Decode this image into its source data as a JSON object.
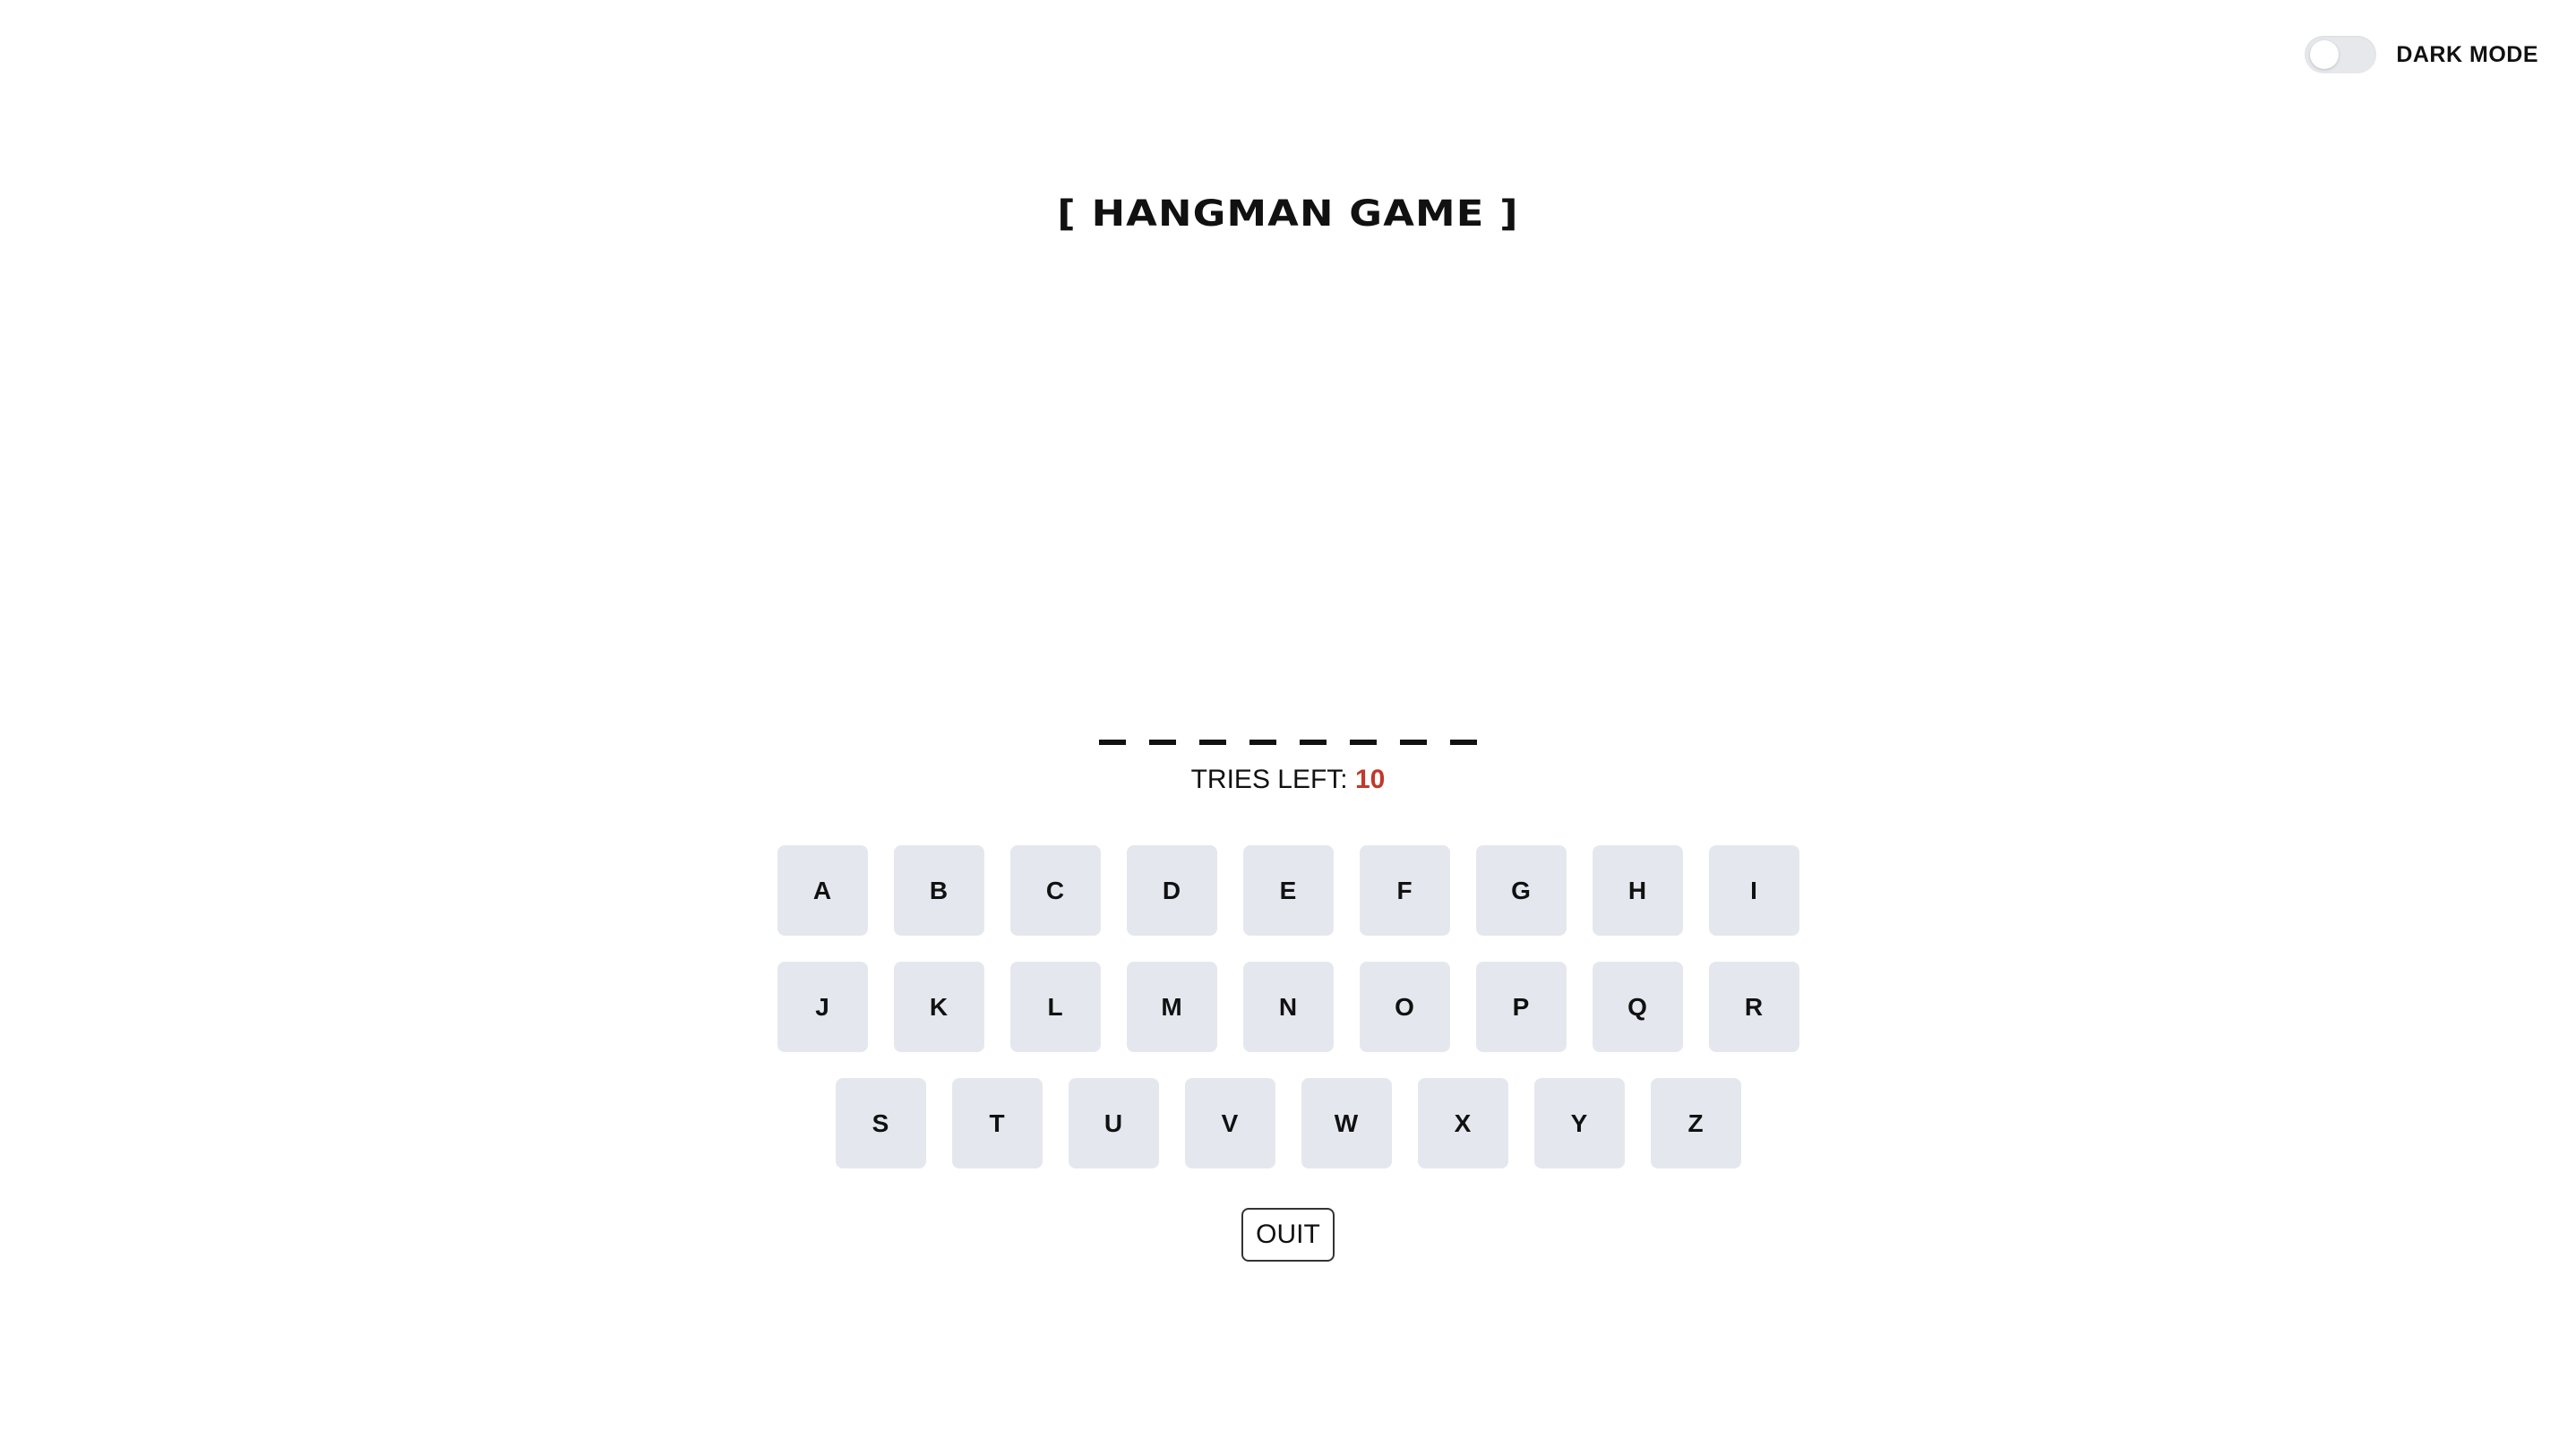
{
  "header": {
    "dark_mode_label": "DARK MODE",
    "dark_mode_on": false
  },
  "game": {
    "title": "[ HANGMAN GAME ]",
    "word_length": 8,
    "tries_label": "TRIES LEFT:",
    "tries_left": "10",
    "tries_color": "#c0392b"
  },
  "keyboard": {
    "rows": [
      [
        "A",
        "B",
        "C",
        "D",
        "E",
        "F",
        "G",
        "H",
        "I"
      ],
      [
        "J",
        "K",
        "L",
        "M",
        "N",
        "O",
        "P",
        "Q",
        "R"
      ],
      [
        "S",
        "T",
        "U",
        "V",
        "W",
        "X",
        "Y",
        "Z"
      ]
    ],
    "key_color": "#e4e8ee"
  },
  "actions": {
    "quit_label": "OUIT"
  }
}
